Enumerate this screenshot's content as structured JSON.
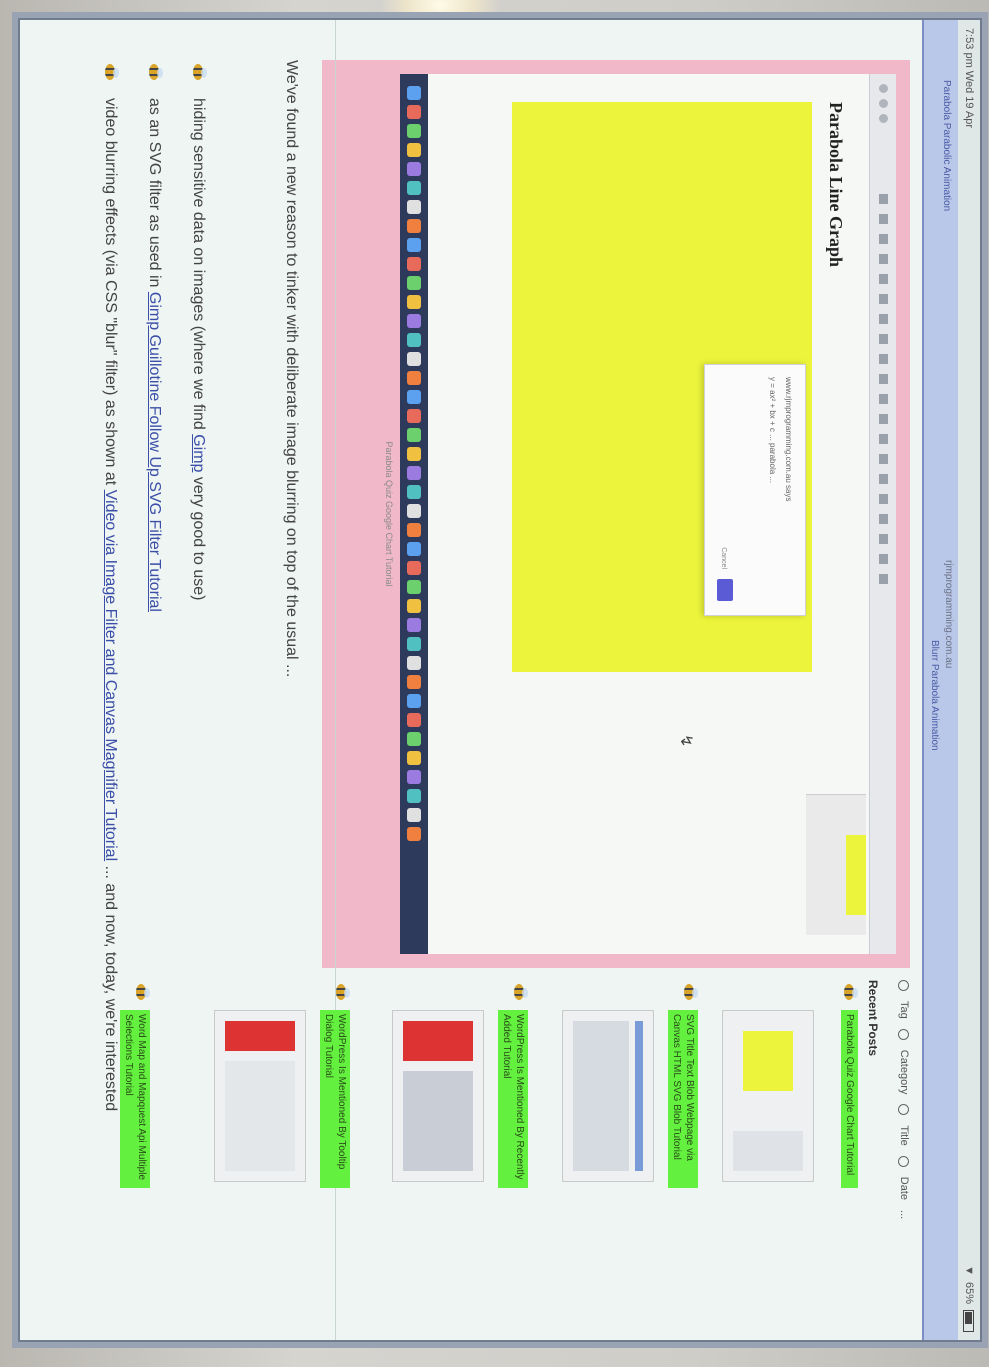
{
  "status": {
    "time": "7:53 pm  Wed 19 Apr",
    "battery": "65%"
  },
  "browser": {
    "tab_left": "Parabola Parabolic Animation",
    "url": "rjmprogramming.com.au",
    "tab_right": "Blurr Parabola Animation"
  },
  "screenshot_figure": {
    "heading": "Parabola Line Graph",
    "caption": "Parabola Quiz Google Chart Tutorial",
    "dialog_line1": "www.rjmprogramming.com.au says",
    "dialog_line2": "y = ax² + bx + c ... parabola ...",
    "dialog_ok": "OK",
    "dialog_cancel": "Cancel"
  },
  "article": {
    "intro": "We've found a new reason to tinker with deliberate image blurring on top of the usual ...",
    "bullets": [
      {
        "before": "hiding sensitive data on images (where we find ",
        "link": "Gimp",
        "after": " very good to use)"
      },
      {
        "before": "as an SVG filter as used in ",
        "link": "Gimp Guillotine Follow Up SVG Filter Tutorial",
        "after": ""
      },
      {
        "before": "video blurring effects (via CSS \"blur\" filter) as shown at ",
        "link": "Video via Image Filter and Canvas Magnifier Tutorial",
        "after": " ... and now, today, we're interested"
      }
    ]
  },
  "sidebar": {
    "options": [
      "Tag",
      "Category",
      "Title",
      "Date",
      "..."
    ],
    "recent_title": "Recent Posts",
    "posts": [
      {
        "title": "Parabola Quiz Google Chart Tutorial"
      },
      {
        "title": "SVG Title Text Blob Webpage via Canvas HTML SVG Blob Tutorial"
      },
      {
        "title": "WordPress Is Mentioned By Recently Added Tutorial"
      },
      {
        "title": "WordPress Is Mentioned By Tooltip Dialog Tutorial"
      },
      {
        "title": "Word Map and Mapquest Api Multiple Selections Tutorial"
      }
    ]
  }
}
